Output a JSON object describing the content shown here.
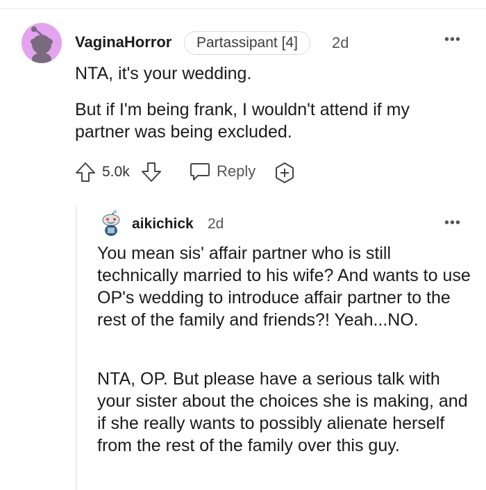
{
  "comment": {
    "username": "VaginaHorror",
    "flair": "Partassipant [4]",
    "time": "2d",
    "more": "•••",
    "paragraph1": "NTA, it's your wedding.",
    "paragraph2": "But if I'm being frank, I wouldn't attend if my partner was being excluded.",
    "actions": {
      "score": "5.0k",
      "reply_label": "Reply",
      "upvote_icon": "upvote-arrow-icon",
      "downvote_icon": "downvote-arrow-icon",
      "reply_icon": "speech-bubble-icon",
      "award_icon": "award-plus-icon"
    },
    "avatar_color": "#e4a3ef"
  },
  "reply_comment": {
    "username": "aikichick",
    "time": "2d",
    "more": "•••",
    "paragraph1": "You mean sis' affair partner who is still technically married to his wife? And wants to use OP's wedding to introduce affair partner to the rest of the family and friends?! Yeah...NO.",
    "paragraph2": "NTA, OP. But please have a serious talk with your sister about the choices she is making, and if she really wants to possibly alienate herself from the rest of the family over this guy.",
    "avatar_icon": "snoo-avatar-icon"
  }
}
